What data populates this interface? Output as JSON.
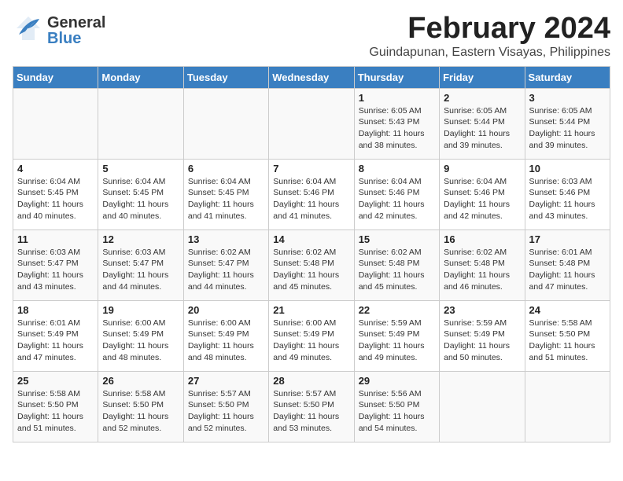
{
  "header": {
    "logo_general": "General",
    "logo_blue": "Blue",
    "month": "February 2024",
    "location": "Guindapunan, Eastern Visayas, Philippines"
  },
  "days_of_week": [
    "Sunday",
    "Monday",
    "Tuesday",
    "Wednesday",
    "Thursday",
    "Friday",
    "Saturday"
  ],
  "weeks": [
    [
      {
        "day": "",
        "info": ""
      },
      {
        "day": "",
        "info": ""
      },
      {
        "day": "",
        "info": ""
      },
      {
        "day": "",
        "info": ""
      },
      {
        "day": "1",
        "info": "Sunrise: 6:05 AM\nSunset: 5:43 PM\nDaylight: 11 hours\nand 38 minutes."
      },
      {
        "day": "2",
        "info": "Sunrise: 6:05 AM\nSunset: 5:44 PM\nDaylight: 11 hours\nand 39 minutes."
      },
      {
        "day": "3",
        "info": "Sunrise: 6:05 AM\nSunset: 5:44 PM\nDaylight: 11 hours\nand 39 minutes."
      }
    ],
    [
      {
        "day": "4",
        "info": "Sunrise: 6:04 AM\nSunset: 5:45 PM\nDaylight: 11 hours\nand 40 minutes."
      },
      {
        "day": "5",
        "info": "Sunrise: 6:04 AM\nSunset: 5:45 PM\nDaylight: 11 hours\nand 40 minutes."
      },
      {
        "day": "6",
        "info": "Sunrise: 6:04 AM\nSunset: 5:45 PM\nDaylight: 11 hours\nand 41 minutes."
      },
      {
        "day": "7",
        "info": "Sunrise: 6:04 AM\nSunset: 5:46 PM\nDaylight: 11 hours\nand 41 minutes."
      },
      {
        "day": "8",
        "info": "Sunrise: 6:04 AM\nSunset: 5:46 PM\nDaylight: 11 hours\nand 42 minutes."
      },
      {
        "day": "9",
        "info": "Sunrise: 6:04 AM\nSunset: 5:46 PM\nDaylight: 11 hours\nand 42 minutes."
      },
      {
        "day": "10",
        "info": "Sunrise: 6:03 AM\nSunset: 5:46 PM\nDaylight: 11 hours\nand 43 minutes."
      }
    ],
    [
      {
        "day": "11",
        "info": "Sunrise: 6:03 AM\nSunset: 5:47 PM\nDaylight: 11 hours\nand 43 minutes."
      },
      {
        "day": "12",
        "info": "Sunrise: 6:03 AM\nSunset: 5:47 PM\nDaylight: 11 hours\nand 44 minutes."
      },
      {
        "day": "13",
        "info": "Sunrise: 6:02 AM\nSunset: 5:47 PM\nDaylight: 11 hours\nand 44 minutes."
      },
      {
        "day": "14",
        "info": "Sunrise: 6:02 AM\nSunset: 5:48 PM\nDaylight: 11 hours\nand 45 minutes."
      },
      {
        "day": "15",
        "info": "Sunrise: 6:02 AM\nSunset: 5:48 PM\nDaylight: 11 hours\nand 45 minutes."
      },
      {
        "day": "16",
        "info": "Sunrise: 6:02 AM\nSunset: 5:48 PM\nDaylight: 11 hours\nand 46 minutes."
      },
      {
        "day": "17",
        "info": "Sunrise: 6:01 AM\nSunset: 5:48 PM\nDaylight: 11 hours\nand 47 minutes."
      }
    ],
    [
      {
        "day": "18",
        "info": "Sunrise: 6:01 AM\nSunset: 5:49 PM\nDaylight: 11 hours\nand 47 minutes."
      },
      {
        "day": "19",
        "info": "Sunrise: 6:00 AM\nSunset: 5:49 PM\nDaylight: 11 hours\nand 48 minutes."
      },
      {
        "day": "20",
        "info": "Sunrise: 6:00 AM\nSunset: 5:49 PM\nDaylight: 11 hours\nand 48 minutes."
      },
      {
        "day": "21",
        "info": "Sunrise: 6:00 AM\nSunset: 5:49 PM\nDaylight: 11 hours\nand 49 minutes."
      },
      {
        "day": "22",
        "info": "Sunrise: 5:59 AM\nSunset: 5:49 PM\nDaylight: 11 hours\nand 49 minutes."
      },
      {
        "day": "23",
        "info": "Sunrise: 5:59 AM\nSunset: 5:49 PM\nDaylight: 11 hours\nand 50 minutes."
      },
      {
        "day": "24",
        "info": "Sunrise: 5:58 AM\nSunset: 5:50 PM\nDaylight: 11 hours\nand 51 minutes."
      }
    ],
    [
      {
        "day": "25",
        "info": "Sunrise: 5:58 AM\nSunset: 5:50 PM\nDaylight: 11 hours\nand 51 minutes."
      },
      {
        "day": "26",
        "info": "Sunrise: 5:58 AM\nSunset: 5:50 PM\nDaylight: 11 hours\nand 52 minutes."
      },
      {
        "day": "27",
        "info": "Sunrise: 5:57 AM\nSunset: 5:50 PM\nDaylight: 11 hours\nand 52 minutes."
      },
      {
        "day": "28",
        "info": "Sunrise: 5:57 AM\nSunset: 5:50 PM\nDaylight: 11 hours\nand 53 minutes."
      },
      {
        "day": "29",
        "info": "Sunrise: 5:56 AM\nSunset: 5:50 PM\nDaylight: 11 hours\nand 54 minutes."
      },
      {
        "day": "",
        "info": ""
      },
      {
        "day": "",
        "info": ""
      }
    ]
  ]
}
